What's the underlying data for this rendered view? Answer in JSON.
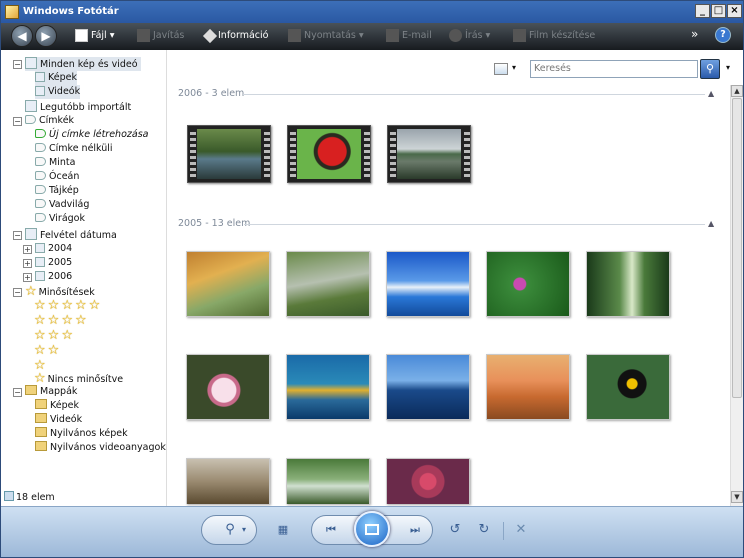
{
  "window": {
    "title": "Windows Fotótár",
    "minimize": "_",
    "maximize": "□",
    "close": "×"
  },
  "toolbar": {
    "back_icon": "back-arrow",
    "forward_icon": "forward-arrow",
    "items": [
      {
        "label": "Fájl",
        "enabled": true,
        "dropdown": true
      },
      {
        "label": "Javítás",
        "enabled": false,
        "dropdown": false
      },
      {
        "label": "Információ",
        "enabled": true,
        "dropdown": false
      },
      {
        "label": "Nyomtatás",
        "enabled": false,
        "dropdown": true
      },
      {
        "label": "E-mail",
        "enabled": false,
        "dropdown": false
      },
      {
        "label": "Írás",
        "enabled": false,
        "dropdown": true
      },
      {
        "label": "Film készítése",
        "enabled": false,
        "dropdown": false
      }
    ],
    "more": "»",
    "help": "?"
  },
  "search": {
    "placeholder": "Keresés"
  },
  "nav": {
    "all": "Minden kép és videó",
    "pictures": "Képek",
    "videos": "Videók",
    "recent": "Legutóbb importált",
    "tags": "Címkék",
    "new_tag": "Új címke létrehozása",
    "untagged": "Címke nélküli",
    "tag_items": [
      "Minta",
      "Óceán",
      "Tájkép",
      "Vadvilág",
      "Virágok"
    ],
    "date_taken": "Felvétel dátuma",
    "years": [
      "2004",
      "2005",
      "2006"
    ],
    "ratings": "Minősítések",
    "not_rated": "Nincs minősítve",
    "folders": "Mappák",
    "folder_items": [
      "Képek",
      "Videók",
      "Nyilvános képek",
      "Nyilvános videoanyagok"
    ]
  },
  "groups": [
    {
      "label": "2006 - 3 elem"
    },
    {
      "label": "2005 - 13 elem"
    }
  ],
  "status": "18 elem",
  "colors": {
    "titlebar": "#2a58a3",
    "toolbar": "#1e2226",
    "accent": "#1a62c4",
    "star": "#f4c21a"
  }
}
